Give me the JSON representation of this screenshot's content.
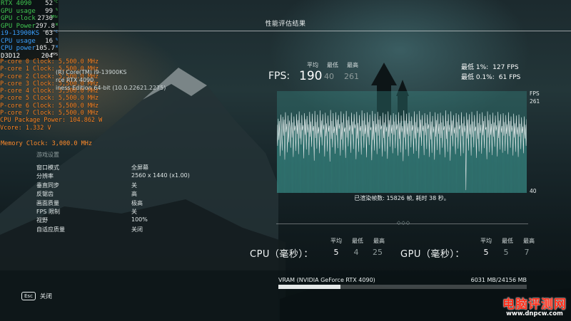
{
  "osd": {
    "rows": [
      {
        "key": "RTX 4090",
        "value": "52",
        "unit": "°C",
        "color": "green"
      },
      {
        "key": "GPU usage",
        "value": "99",
        "unit": "%",
        "color": "green"
      },
      {
        "key": "GPU clock",
        "value": "2730",
        "unit": "MHz",
        "color": "green"
      },
      {
        "key": "GPU Power",
        "value": "297.8",
        "unit": "W",
        "color": "green"
      },
      {
        "key": "i9-13900KS",
        "value": "63",
        "unit": "°C",
        "color": "blue"
      },
      {
        "key": "CPU usage",
        "value": "16",
        "unit": "%",
        "color": "blue"
      },
      {
        "key": "CPU power",
        "value": "105.7",
        "unit": "W",
        "color": "blue"
      },
      {
        "key": "D3D12",
        "value": "204",
        "unit": "FPS",
        "color": "white"
      }
    ],
    "core_lines": [
      "P-core 0 Clock: 5,500.0 MHz",
      "P-core 1 Clock: 5,500.0 MHz",
      "P-core 2 Clock: 5,500.0 MHz",
      "P-core 3 Clock: 5,500.0 MHz",
      "P-core 4 Clock: 5,500.0 MHz",
      "P-core 5 Clock: 5,500.0 MHz",
      "P-core 6 Clock: 5,500.0 MHz",
      "P-core 7 Clock: 5,500.0 MHz",
      "CPU Package Power: 104.862 W",
      "Vcore: 1.332 V"
    ],
    "memory_line": "Memory Clock: 3,000.0 MHz"
  },
  "system_info": [
    "(R) Core(TM) i9-13900KS",
    "rce RTX 4090",
    "iness Edition 64-bit (10.0.22621.2275)"
  ],
  "header": {
    "title": "性能评估结果"
  },
  "settings": {
    "section_title": "游戏设置",
    "rows": [
      {
        "label": "窗口模式",
        "value": "全屏幕"
      },
      {
        "label": "分辨率",
        "value": "2560 x 1440 (x1.00)"
      },
      {
        "label": "垂直同步",
        "value": "关"
      },
      {
        "label": "反锯齿",
        "value": "高"
      },
      {
        "label": "画面质量",
        "value": "极高"
      },
      {
        "label": "FPS 限制",
        "value": "关"
      },
      {
        "label": "视野",
        "value": "100%"
      },
      {
        "label": "自适应质量",
        "value": "关闭"
      }
    ]
  },
  "fps": {
    "label": "FPS:",
    "col_avg": "平均",
    "col_min": "最低",
    "col_max": "最高",
    "avg": "190",
    "min": "40",
    "max": "261",
    "low1_label": "最低 1%:",
    "low1_value": "127 FPS",
    "low01_label": "最低 0.1%:",
    "low01_value": "61 FPS",
    "graph_unit": "FPS",
    "graph_max": "261",
    "graph_min": "40",
    "frames_text": "已渲染帧数: 15826 帧, 耗时 38 秒。"
  },
  "chart_data": {
    "type": "line",
    "ylim": [
      40,
      261
    ],
    "series": [
      {
        "values": [
          188,
          142,
          201,
          155,
          196,
          120,
          210,
          178,
          132,
          205,
          164,
          199,
          112,
          215,
          172,
          190,
          128,
          208,
          150,
          197,
          181,
          138,
          214,
          160,
          193,
          118,
          206,
          175,
          186,
          131,
          211,
          168,
          198,
          124,
          217,
          158,
          192,
          145,
          209,
          176,
          187,
          115,
          213,
          166,
          200,
          134,
          207,
          171,
          189,
          122,
          216,
          162,
          195,
          140,
          212,
          174,
          185,
          110,
          218,
          159,
          194,
          136,
          210,
          169,
          183,
          126,
          219,
          161,
          197,
          143,
          211,
          177,
          188,
          119,
          214,
          163,
          191,
          130,
          208,
          173,
          186,
          108,
          220,
          157,
          196,
          139,
          213,
          170,
          184,
          125,
          215,
          165,
          199,
          137,
          209,
          179,
          190,
          121,
          217,
          156,
          193,
          133,
          212,
          172,
          182,
          116,
          218,
          160,
          198,
          141,
          206,
          175,
          187,
          127,
          214,
          167,
          195,
          135,
          211,
          180,
          189,
          113,
          216,
          158,
          192,
          129,
          209,
          174,
          185,
          123,
          219,
          163,
          197,
          138,
          213,
          168,
          188,
          117,
          215,
          161,
          194,
          144,
          210,
          176,
          183,
          111,
          218,
          155,
          196,
          132,
          212,
          171,
          190,
          124,
          216,
          164,
          199,
          136,
          207,
          178,
          186,
          119,
          214,
          159,
          193,
          130,
          211,
          173,
          184,
          114,
          217,
          162,
          198,
          140,
          209,
          169,
          188,
          126,
          213,
          166,
          195,
          137,
          210,
          177,
          189,
          121,
          215,
          157,
          192,
          128,
          208,
          172,
          185,
          109,
          219,
          160,
          197,
          134,
          212,
          167,
          191,
          120,
          214,
          163,
          196,
          139,
          206,
          175,
          187,
          125,
          217,
          158,
          194,
          131,
          211,
          170,
          183,
          115,
          218,
          161,
          199,
          142,
          209,
          174,
          186,
          122,
          213,
          165,
          192,
          135,
          210,
          179,
          189,
          118,
          216,
          156,
          195,
          127,
          207,
          171,
          184,
          112,
          215,
          162,
          198,
          133,
          212,
          168,
          190,
          123,
          214,
          159,
          193,
          138,
          208,
          176,
          185,
          117,
          219,
          157,
          196,
          129,
          211,
          173,
          188,
          110,
          217,
          164,
          197,
          141,
          209,
          169,
          182,
          124,
          213,
          160,
          194,
          136,
          210,
          178,
          187,
          120,
          215,
          163,
          191,
          126,
          206,
          172,
          186,
          46,
          214,
          158,
          199,
          132,
          211,
          167,
          189,
          121,
          216,
          161,
          195,
          139,
          209,
          174,
          184,
          116,
          218,
          157,
          192,
          130,
          212,
          170,
          188,
          125,
          215,
          165,
          196,
          137,
          207,
          177,
          183,
          113,
          217,
          160,
          198,
          128,
          210,
          166,
          190,
          122,
          214,
          162,
          193,
          140,
          208,
          175,
          187,
          119,
          216,
          159,
          197,
          134,
          211,
          171,
          185,
          127,
          213,
          164,
          194,
          131,
          209,
          168,
          189,
          124,
          215,
          163,
          196,
          138,
          206,
          173,
          186,
          121,
          212,
          160,
          191,
          129,
          208,
          167,
          183,
          118,
          210,
          162,
          190,
          135,
          204,
          170,
          184,
          126,
          206,
          158,
          188,
          142,
          200
        ]
      }
    ]
  },
  "cpu": {
    "title": "CPU（毫秒）：",
    "col_avg": "平均",
    "col_min": "最低",
    "col_max": "最高",
    "avg": "5",
    "min": "4",
    "max": "25"
  },
  "gpu": {
    "title": "GPU（毫秒）：",
    "col_avg": "平均",
    "col_min": "最低",
    "col_max": "最高",
    "avg": "5",
    "min": "5",
    "max": "7"
  },
  "vram": {
    "label": "VRAM (NVIDIA GeForce RTX 4090)",
    "value": "6031 MB/24156 MB",
    "fraction": 0.2497
  },
  "footer": {
    "esc_key": "Esc",
    "close_label": "关闭"
  },
  "watermark": {
    "main": "电脑评测网",
    "sub": "www.dnpcw.com"
  },
  "colors": {
    "osd_green": "#41c651",
    "osd_blue": "#3aa0ff",
    "osd_orange": "#ff8a2a",
    "graph_fill": "#3a8f8a",
    "watermark_red": "#ff2d18"
  }
}
